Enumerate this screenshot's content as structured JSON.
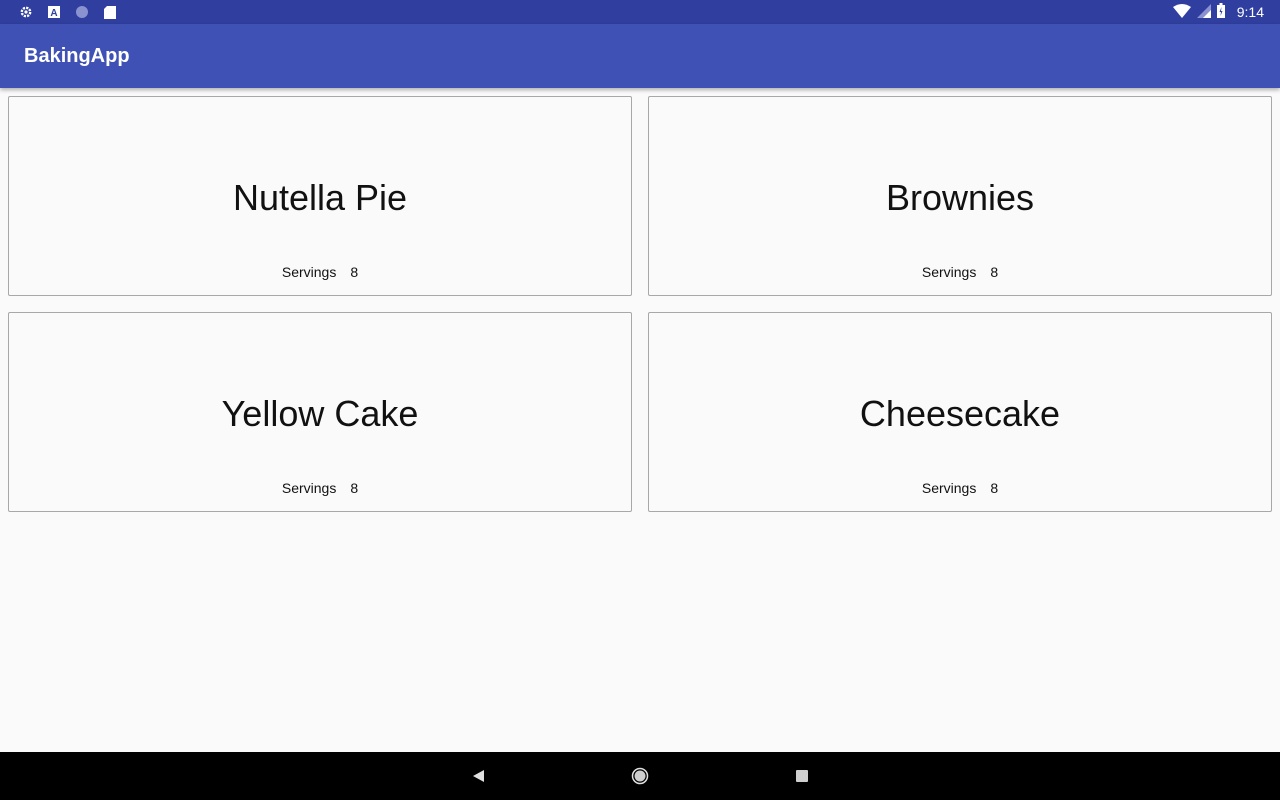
{
  "status_bar": {
    "time": "9:14",
    "left_icons": [
      "settings-icon",
      "font-a-icon",
      "circle-icon",
      "sd-card-icon"
    ],
    "right_icons": [
      "wifi-icon",
      "signal-icon",
      "battery-icon"
    ]
  },
  "app_bar": {
    "title": "BakingApp"
  },
  "recipes": [
    {
      "name": "Nutella Pie",
      "servings_label": "Servings",
      "servings": "8"
    },
    {
      "name": "Brownies",
      "servings_label": "Servings",
      "servings": "8"
    },
    {
      "name": "Yellow Cake",
      "servings_label": "Servings",
      "servings": "8"
    },
    {
      "name": "Cheesecake",
      "servings_label": "Servings",
      "servings": "8"
    }
  ],
  "nav_bar": {
    "buttons": [
      "back-icon",
      "home-icon",
      "recents-icon"
    ]
  },
  "colors": {
    "status_bar": "#303f9f",
    "app_bar": "#3f51b5",
    "background": "#fafafa",
    "nav_bar": "#000000"
  }
}
